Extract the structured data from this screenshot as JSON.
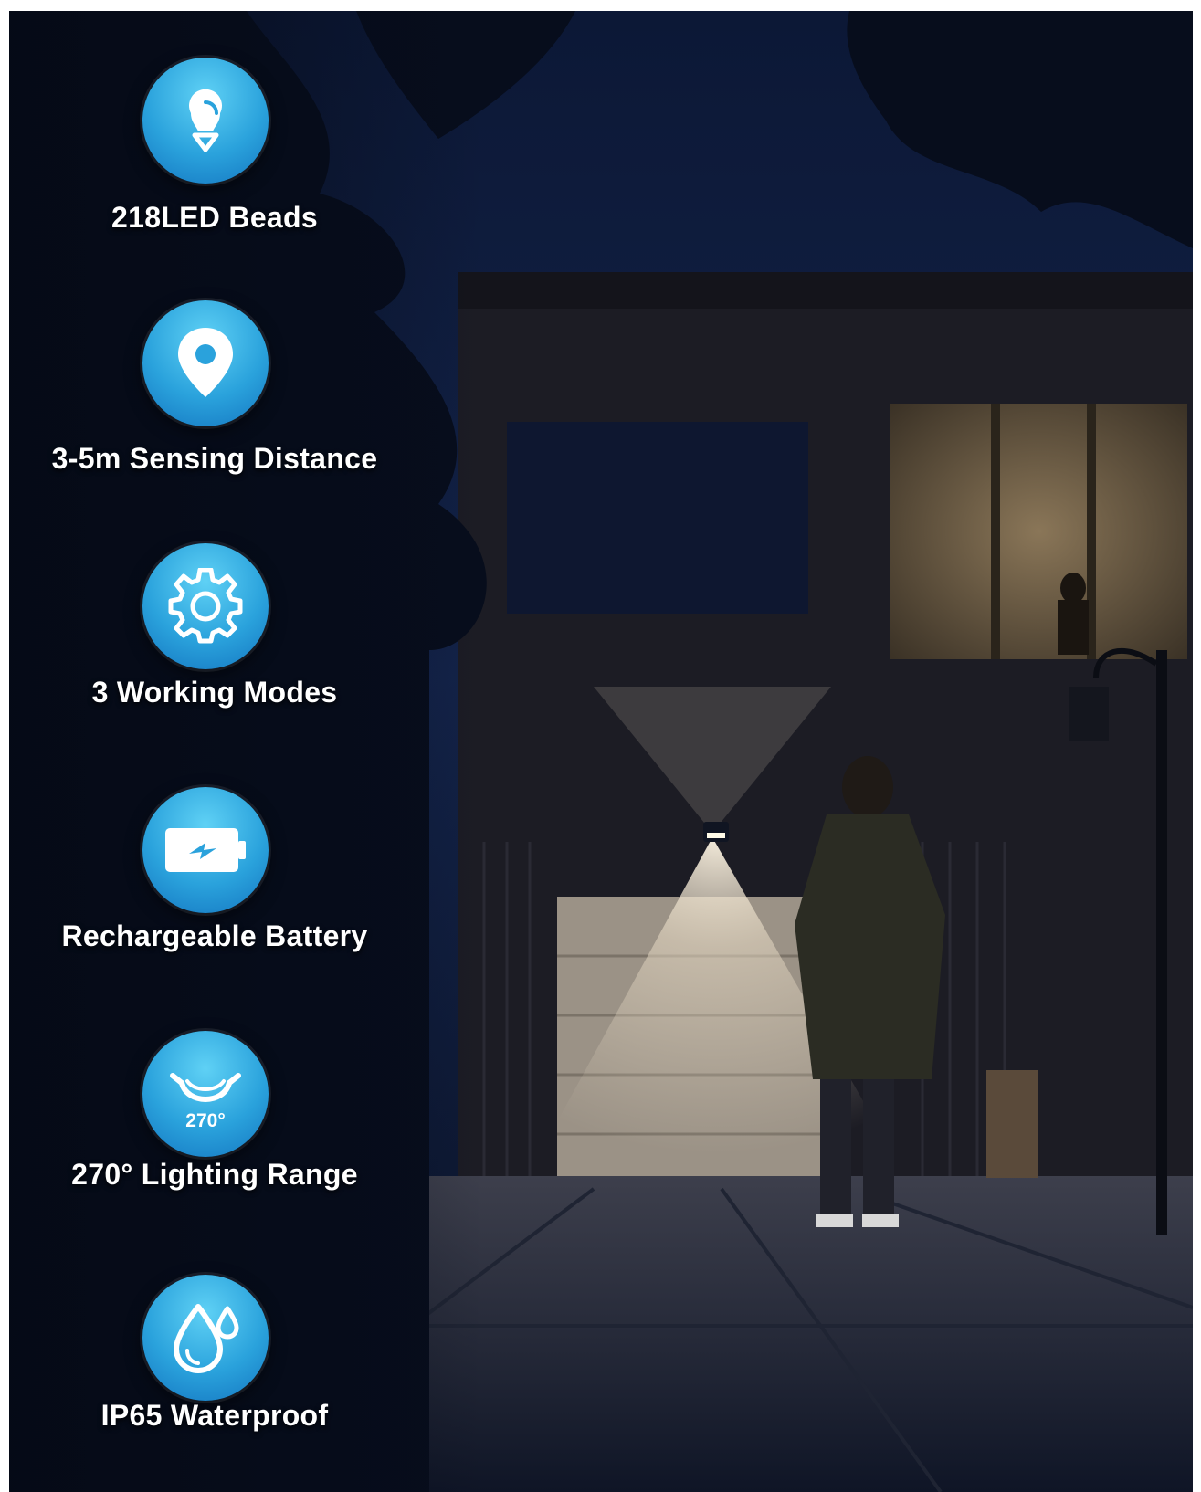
{
  "features": [
    {
      "icon": "led-bulb-icon",
      "label": "218LED Beads"
    },
    {
      "icon": "location-pin-icon",
      "label": "3-5m Sensing Distance"
    },
    {
      "icon": "gear-icon",
      "label": "3 Working Modes"
    },
    {
      "icon": "battery-charging-icon",
      "label": "Rechargeable Battery"
    },
    {
      "icon": "range-angle-icon",
      "label": "270° Lighting Range",
      "icon_text": "270°"
    },
    {
      "icon": "water-drops-icon",
      "label": "IP65 Waterproof"
    }
  ],
  "colors": {
    "badge": "#2aa2dc",
    "label_text": "#ffffff",
    "sky": "#0b1428"
  }
}
